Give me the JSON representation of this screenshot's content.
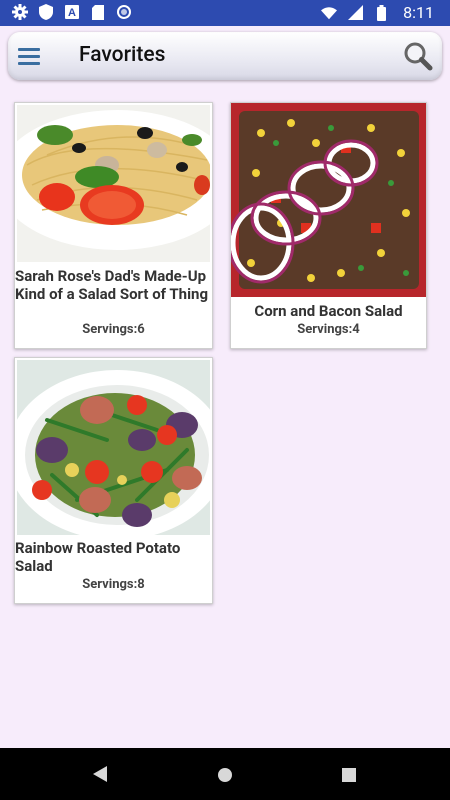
{
  "status_bar": {
    "time": "8:11",
    "left_icons": [
      "gear-icon",
      "shield-icon",
      "font-a-icon",
      "sd-card-icon",
      "circle-icon"
    ],
    "right_icons": [
      "wifi-icon",
      "signal-icon",
      "battery-icon"
    ]
  },
  "app_bar": {
    "title": "Favorites",
    "menu_icon": "hamburger-menu-icon",
    "search_icon": "search-icon"
  },
  "recipes": [
    {
      "title": "Sarah Rose's Dad's Made-Up Kind of a Salad Sort of Thing",
      "servings": "Servings:6"
    },
    {
      "title": "Corn and Bacon Salad",
      "servings": "Servings:4"
    },
    {
      "title": "Rainbow Roasted Potato Salad",
      "servings": "Servings:8"
    }
  ],
  "nav_bar": [
    "back-icon",
    "home-icon",
    "recents-icon"
  ]
}
